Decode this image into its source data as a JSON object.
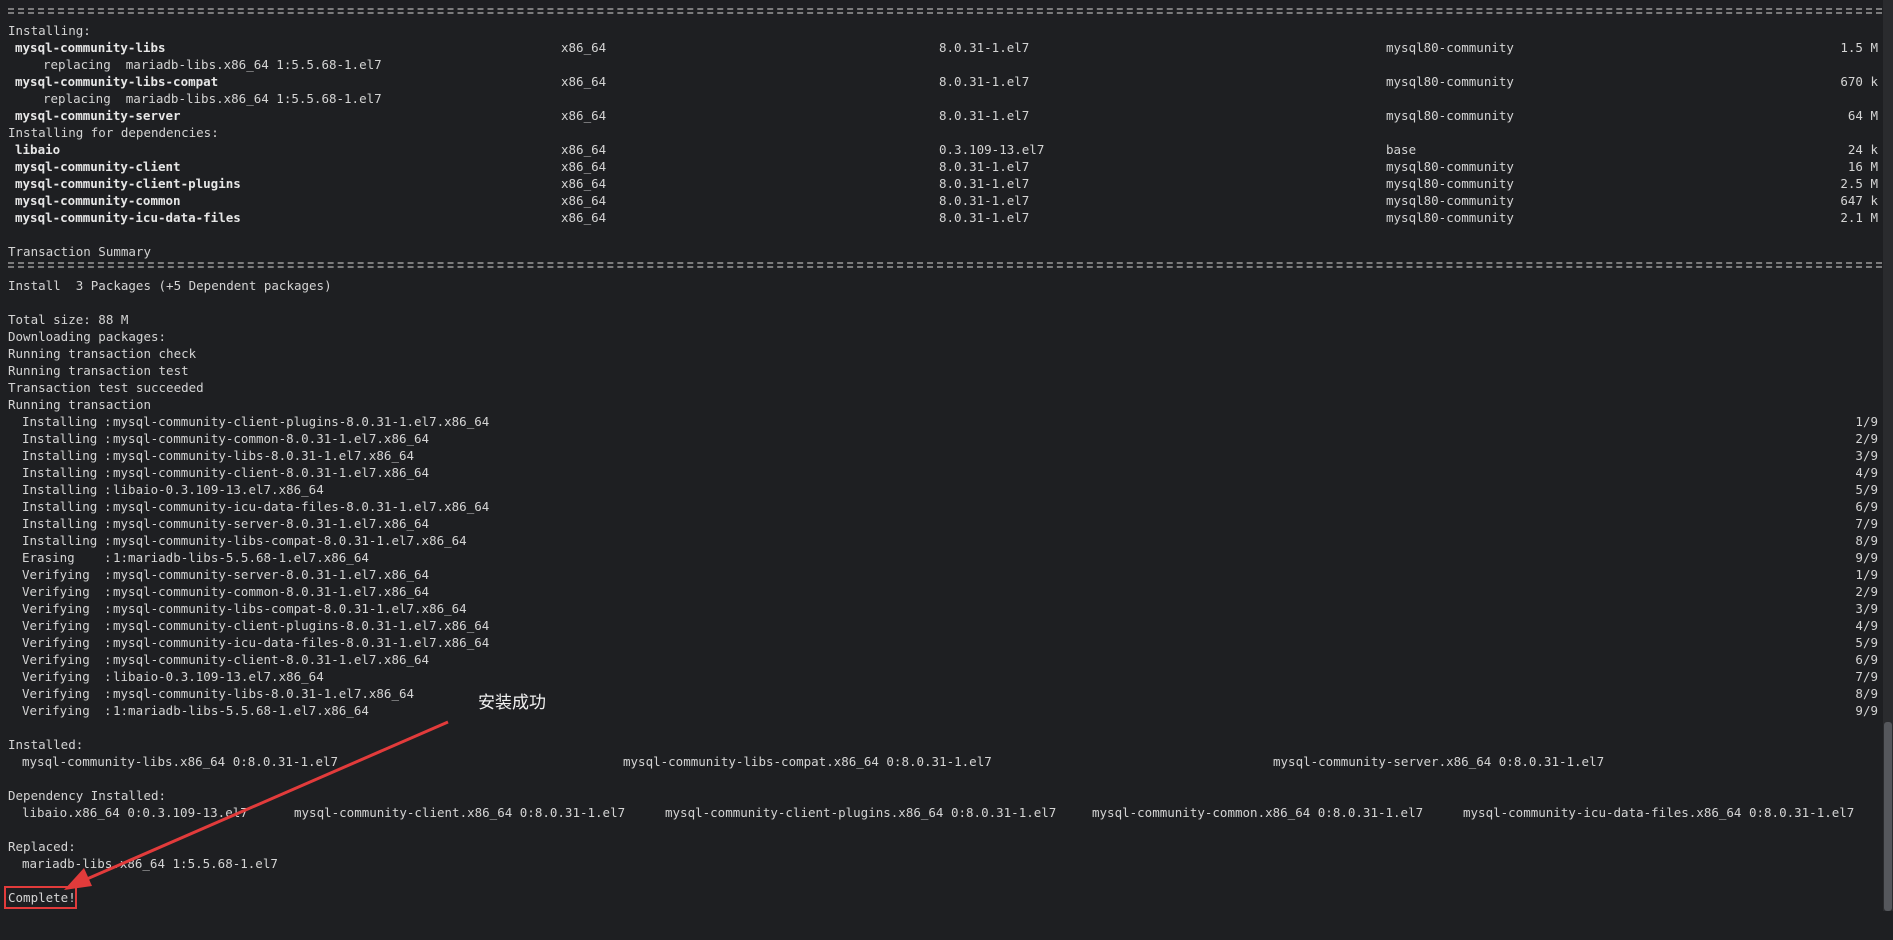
{
  "installing_header": "Installing:",
  "installing_pkgs": [
    {
      "name": "mysql-community-libs",
      "arch": "x86_64",
      "version": "8.0.31-1.el7",
      "repo": "mysql80-community",
      "size": "1.5 M"
    },
    {
      "name": "mysql-community-libs-compat",
      "arch": "x86_64",
      "version": "8.0.31-1.el7",
      "repo": "mysql80-community",
      "size": "670 k"
    },
    {
      "name": "mysql-community-server",
      "arch": "x86_64",
      "version": "8.0.31-1.el7",
      "repo": "mysql80-community",
      "size": "64 M"
    }
  ],
  "replacing_lines": [
    "replacing  mariadb-libs.x86_64 1:5.5.68-1.el7",
    "replacing  mariadb-libs.x86_64 1:5.5.68-1.el7"
  ],
  "deps_header": "Installing for dependencies:",
  "deps_pkgs": [
    {
      "name": "libaio",
      "arch": "x86_64",
      "version": "0.3.109-13.el7",
      "repo": "base",
      "size": "24 k"
    },
    {
      "name": "mysql-community-client",
      "arch": "x86_64",
      "version": "8.0.31-1.el7",
      "repo": "mysql80-community",
      "size": "16 M"
    },
    {
      "name": "mysql-community-client-plugins",
      "arch": "x86_64",
      "version": "8.0.31-1.el7",
      "repo": "mysql80-community",
      "size": "2.5 M"
    },
    {
      "name": "mysql-community-common",
      "arch": "x86_64",
      "version": "8.0.31-1.el7",
      "repo": "mysql80-community",
      "size": "647 k"
    },
    {
      "name": "mysql-community-icu-data-files",
      "arch": "x86_64",
      "version": "8.0.31-1.el7",
      "repo": "mysql80-community",
      "size": "2.1 M"
    }
  ],
  "transaction_summary": "Transaction Summary",
  "install_line": "Install  3 Packages (+5 Dependent packages)",
  "total_size": "Total size: 88 M",
  "status_lines": [
    "Downloading packages:",
    "Running transaction check",
    "Running transaction test",
    "Transaction test succeeded",
    "Running transaction"
  ],
  "steps": [
    {
      "action": "Installing",
      "target": "mysql-community-client-plugins-8.0.31-1.el7.x86_64",
      "count": "1/9"
    },
    {
      "action": "Installing",
      "target": "mysql-community-common-8.0.31-1.el7.x86_64",
      "count": "2/9"
    },
    {
      "action": "Installing",
      "target": "mysql-community-libs-8.0.31-1.el7.x86_64",
      "count": "3/9"
    },
    {
      "action": "Installing",
      "target": "mysql-community-client-8.0.31-1.el7.x86_64",
      "count": "4/9"
    },
    {
      "action": "Installing",
      "target": "libaio-0.3.109-13.el7.x86_64",
      "count": "5/9"
    },
    {
      "action": "Installing",
      "target": "mysql-community-icu-data-files-8.0.31-1.el7.x86_64",
      "count": "6/9"
    },
    {
      "action": "Installing",
      "target": "mysql-community-server-8.0.31-1.el7.x86_64",
      "count": "7/9"
    },
    {
      "action": "Installing",
      "target": "mysql-community-libs-compat-8.0.31-1.el7.x86_64",
      "count": "8/9"
    },
    {
      "action": "Erasing   ",
      "target": "1:mariadb-libs-5.5.68-1.el7.x86_64",
      "count": "9/9"
    },
    {
      "action": "Verifying ",
      "target": "mysql-community-server-8.0.31-1.el7.x86_64",
      "count": "1/9"
    },
    {
      "action": "Verifying ",
      "target": "mysql-community-common-8.0.31-1.el7.x86_64",
      "count": "2/9"
    },
    {
      "action": "Verifying ",
      "target": "mysql-community-libs-compat-8.0.31-1.el7.x86_64",
      "count": "3/9"
    },
    {
      "action": "Verifying ",
      "target": "mysql-community-client-plugins-8.0.31-1.el7.x86_64",
      "count": "4/9"
    },
    {
      "action": "Verifying ",
      "target": "mysql-community-icu-data-files-8.0.31-1.el7.x86_64",
      "count": "5/9"
    },
    {
      "action": "Verifying ",
      "target": "mysql-community-client-8.0.31-1.el7.x86_64",
      "count": "6/9"
    },
    {
      "action": "Verifying ",
      "target": "libaio-0.3.109-13.el7.x86_64",
      "count": "7/9"
    },
    {
      "action": "Verifying ",
      "target": "mysql-community-libs-8.0.31-1.el7.x86_64",
      "count": "8/9"
    },
    {
      "action": "Verifying ",
      "target": "1:mariadb-libs-5.5.68-1.el7.x86_64",
      "count": "9/9"
    }
  ],
  "installed_header": "Installed:",
  "installed_items": [
    "mysql-community-libs.x86_64 0:8.0.31-1.el7",
    "mysql-community-libs-compat.x86_64 0:8.0.31-1.el7",
    "mysql-community-server.x86_64 0:8.0.31-1.el7"
  ],
  "dep_installed_header": "Dependency Installed:",
  "dep_installed_items": [
    "libaio.x86_64 0:0.3.109-13.el7",
    "mysql-community-client.x86_64 0:8.0.31-1.el7",
    "mysql-community-client-plugins.x86_64 0:8.0.31-1.el7",
    "mysql-community-common.x86_64 0:8.0.31-1.el7",
    "mysql-community-icu-data-files.x86_64 0:8.0.31-1.el7"
  ],
  "replaced_header": "Replaced:",
  "replaced_item": "mariadb-libs.x86_64 1:5.5.68-1.el7",
  "complete": "Complete!",
  "annotation": "安装成功",
  "colors": {
    "background": "#1e1f22",
    "text": "#d4d4d4",
    "annotation_red": "#e23b3b"
  }
}
